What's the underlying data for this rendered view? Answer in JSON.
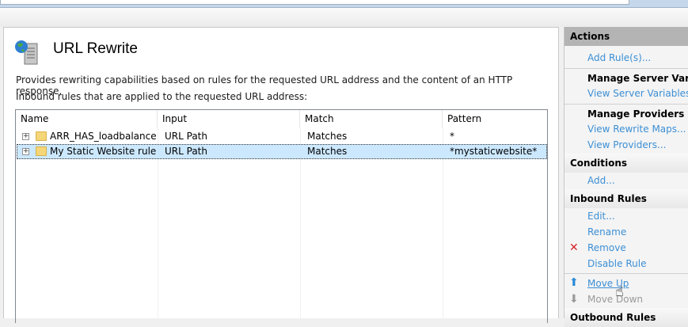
{
  "page": {
    "title": "URL Rewrite",
    "description": "Provides rewriting capabilities based on rules for the requested URL address and the content of an HTTP response.",
    "inbound_label": "Inbound rules that are applied to the requested URL address:"
  },
  "grid": {
    "columns": [
      "Name",
      "Input",
      "Match",
      "Pattern"
    ],
    "rows": [
      {
        "name": "ARR_HAS_loadbalance",
        "input": "URL Path",
        "match": "Matches",
        "pattern": "*",
        "selected": false
      },
      {
        "name": "My Static Website rule",
        "input": "URL Path",
        "match": "Matches",
        "pattern": "*mystaticwebsite*",
        "selected": true
      }
    ]
  },
  "actions": {
    "header": "Actions",
    "add_rules": "Add Rule(s)...",
    "manage_server_vars": "Manage Server Variables",
    "view_server_vars": "View Server Variables...",
    "manage_providers": "Manage Providers",
    "view_rewrite_maps": "View Rewrite Maps...",
    "view_providers": "View Providers...",
    "conditions": "Conditions",
    "add": "Add...",
    "inbound_rules": "Inbound Rules",
    "edit": "Edit...",
    "rename": "Rename",
    "remove": "Remove",
    "disable_rule": "Disable Rule",
    "move_up": "Move Up",
    "move_down": "Move Down",
    "outbound_rules": "Outbound Rules"
  },
  "colors": {
    "link": "#3c8fd5",
    "selection": "#cce8ff",
    "remove": "#d9262b"
  }
}
